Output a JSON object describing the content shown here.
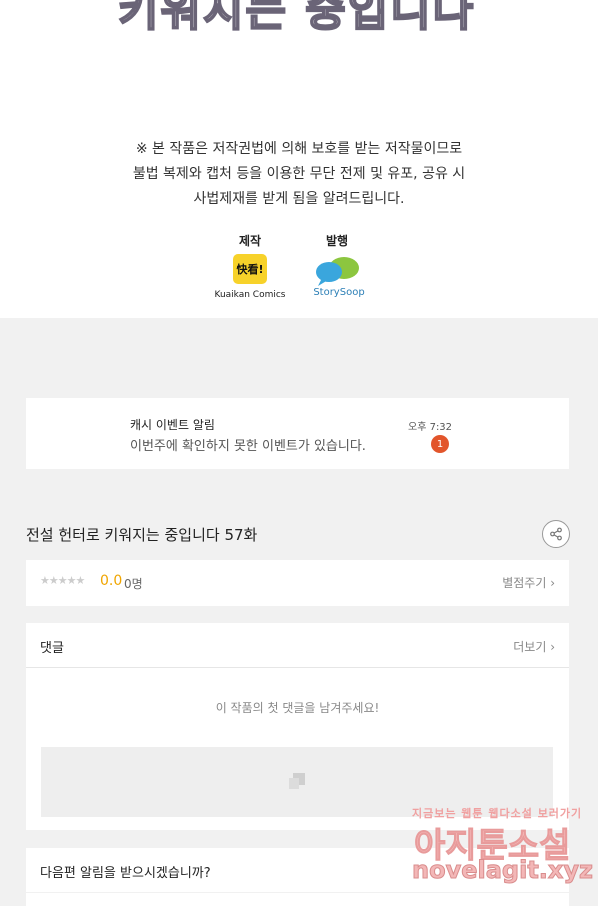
{
  "banner": {
    "title_text": "키워지는 중입니다"
  },
  "notice": {
    "lines": [
      "※ 본 작품은 저작권법에 의해 보호를 받는 저작물이므로",
      "불법 복제와 캡처 등을  이용한 무단 전제 및 유포, 공유 시",
      "사법제재를  받게 됨을 알려드립니다."
    ]
  },
  "credits": {
    "production_label": "제작",
    "production_logo_text": "快看!",
    "production_name": "Kuaikan Comics",
    "publisher_label": "발행",
    "publisher_name": "StorySoop"
  },
  "notification": {
    "title": "캐시 이벤트 알림",
    "body": "이번주에 확인하지 못한 이벤트가 있습니다.",
    "time": "오후 7:32",
    "badge": "1"
  },
  "episode": {
    "title": "전설 헌터로 키워지는 중입니다 57화"
  },
  "rating": {
    "stars": "★★★★★",
    "score": "0.0",
    "count": "0명",
    "rate_link": "별점주기 ›"
  },
  "comments": {
    "heading": "댓글",
    "more_link": "더보기 ›",
    "empty_message": "이 작품의 첫 댓글을 남겨주세요!"
  },
  "next_alert": {
    "question": "다음편 알림을 받으시겠습니까?"
  },
  "watermark": {
    "tagline": "지금보는 웹툰 웹다소설 보러가기",
    "site_name": "아지툰소설",
    "url": "novelagit.xyz"
  },
  "colors": {
    "rating": "#f0a500",
    "badge": "#e2552b",
    "kuaikan_yellow": "#f7d22a",
    "storysoop_blue": "#2c7fb6"
  }
}
